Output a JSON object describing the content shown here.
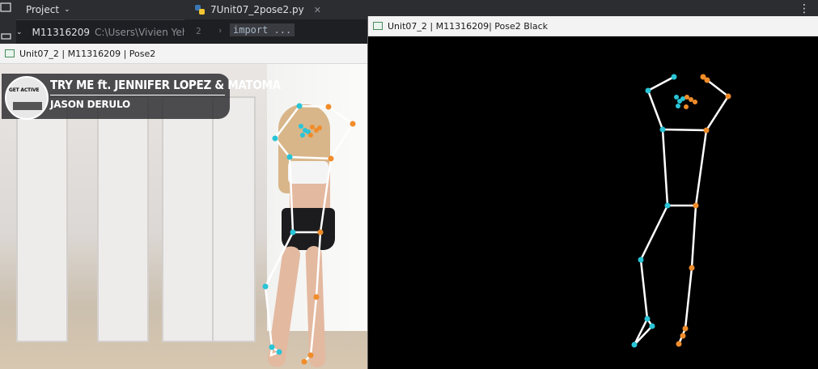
{
  "ide": {
    "project_label": "Project",
    "tab_label": "7Unit07_2pose2.py",
    "tree_folder": "M11316209",
    "tree_path": "C:\\Users\\Vivien Yeh",
    "line_number": "2",
    "code_text": "import ..."
  },
  "left_window": {
    "title": "Unit07_2 | M11316209 | Pose2",
    "banner_badge": "GET ACTIVE",
    "song_title": "TRY ME ft. JENNIFER LOPEZ & MATOMA",
    "song_artist": "JASON DERULO"
  },
  "right_window": {
    "title": "Unit07_2 | M11316209| Pose2 Black"
  },
  "colors": {
    "left_landmark": "#29c4d6",
    "right_landmark": "#f08c2a",
    "skeleton_line": "#ffffff",
    "ide_accent": "#3574f0"
  }
}
